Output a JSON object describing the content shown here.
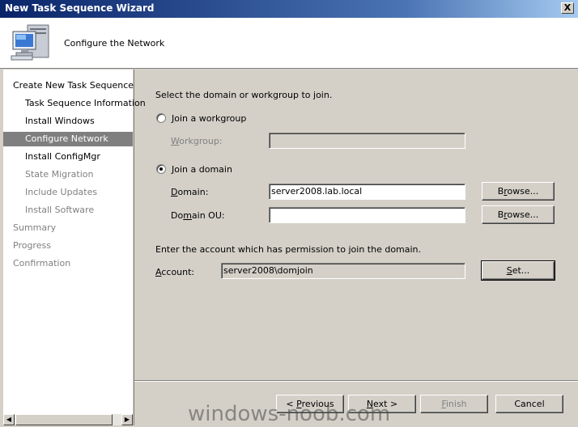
{
  "window": {
    "title": "New Task Sequence Wizard",
    "close_label": "X"
  },
  "header": {
    "title": "Configure the Network",
    "icon": "computer-network-icon"
  },
  "sidebar": {
    "items": [
      {
        "label": "Create New Task Sequence",
        "level": 0,
        "state": "done"
      },
      {
        "label": "Task Sequence Information",
        "level": 1,
        "state": "done"
      },
      {
        "label": "Install Windows",
        "level": 1,
        "state": "done"
      },
      {
        "label": "Configure Network",
        "level": 1,
        "state": "active"
      },
      {
        "label": "Install ConfigMgr",
        "level": 1,
        "state": "done"
      },
      {
        "label": "State Migration",
        "level": 1,
        "state": "todo"
      },
      {
        "label": "Include Updates",
        "level": 1,
        "state": "todo"
      },
      {
        "label": "Install Software",
        "level": 1,
        "state": "todo"
      },
      {
        "label": "Summary",
        "level": 0,
        "state": "todo"
      },
      {
        "label": "Progress",
        "level": 0,
        "state": "todo"
      },
      {
        "label": "Confirmation",
        "level": 0,
        "state": "todo"
      }
    ]
  },
  "main": {
    "intro": "Select the domain or workgroup to join.",
    "workgroup_radio": {
      "prefix": "",
      "accel": "J",
      "rest": "oin a workgroup",
      "checked": false
    },
    "workgroup_label": {
      "accel": "W",
      "rest": "orkgroup:"
    },
    "workgroup_value": "",
    "domain_radio": {
      "accel": "J",
      "rest": "oin a domain",
      "checked": true
    },
    "domain_label": {
      "accel": "D",
      "rest": "omain:"
    },
    "domain_value": "server2008.lab.local",
    "domain_ou_label": {
      "pre": "Do",
      "accel": "m",
      "rest": "ain OU:"
    },
    "domain_ou_value": "",
    "browse_domain": {
      "pre": "B",
      "accel": "r",
      "rest": "owse..."
    },
    "browse_ou": {
      "pre": "B",
      "accel": "r",
      "rest": "owse..."
    },
    "account_intro": "Enter the account which has permission to join the domain.",
    "account_label": {
      "accel": "A",
      "rest": "ccount:"
    },
    "account_value": "server2008\\domjoin",
    "set_button": {
      "accel": "S",
      "rest": "et..."
    }
  },
  "footer": {
    "previous": {
      "pre": "< ",
      "accel": "P",
      "rest": "revious"
    },
    "next": {
      "accel": "N",
      "rest": "ext >"
    },
    "finish": {
      "accel": "F",
      "rest": "inish"
    },
    "cancel": "Cancel"
  },
  "watermark": "windows-noob.com"
}
